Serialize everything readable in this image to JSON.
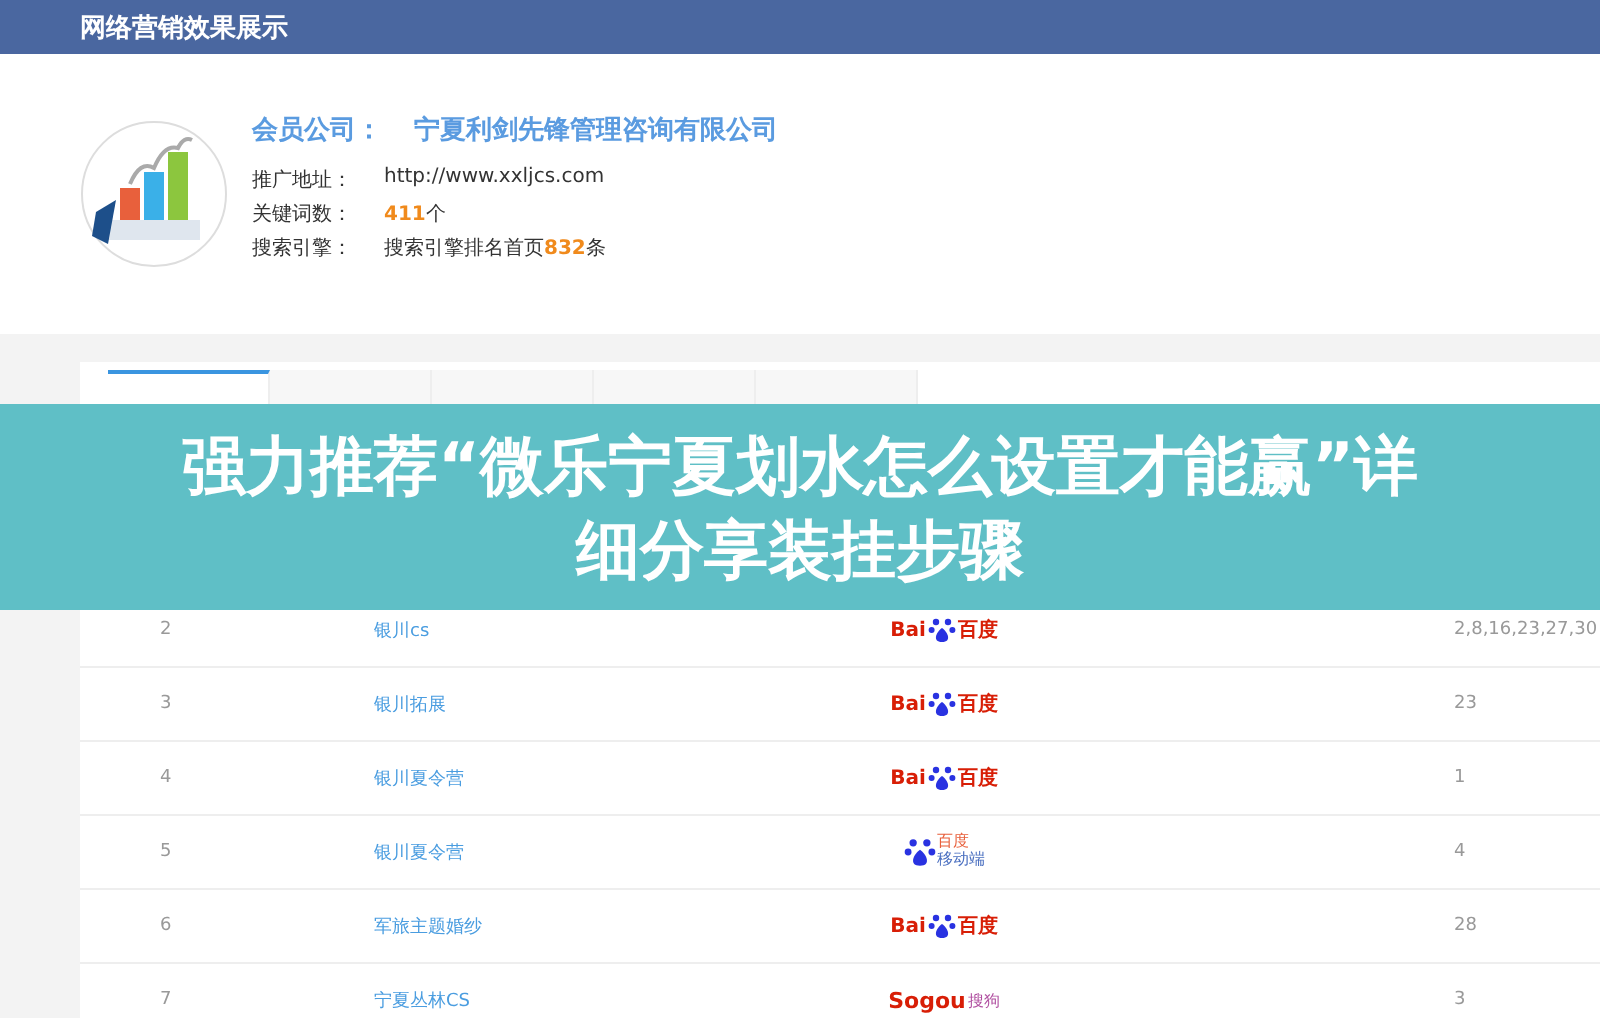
{
  "header": {
    "title": "网络营销效果展示"
  },
  "profile": {
    "company_label": "会员公司：",
    "company": "宁夏利剑先锋管理咨询有限公司",
    "fields": [
      {
        "label": "推广地址：",
        "value": "http://www.xxljcs.com"
      },
      {
        "label": "关键词数：",
        "number": "411",
        "suffix": "个"
      },
      {
        "label": "搜索引擎：",
        "value": "搜索引擎排名首页",
        "number": "832",
        "suffix": "条"
      }
    ]
  },
  "tabs": [
    {
      "selected": true
    },
    {
      "selected": false
    },
    {
      "selected": false
    },
    {
      "selected": false
    },
    {
      "selected": false
    }
  ],
  "table": {
    "rows": [
      {
        "index": "2",
        "keyword": "银川cs",
        "engine": {
          "kind": "baidu",
          "texts": [
            "Bai",
            "百度"
          ]
        },
        "rank": "2,8,16,23,27,30"
      },
      {
        "index": "3",
        "keyword": "银川拓展",
        "engine": {
          "kind": "baidu",
          "texts": [
            "Bai",
            "百度"
          ]
        },
        "rank": "23"
      },
      {
        "index": "4",
        "keyword": "银川夏令营",
        "engine": {
          "kind": "baidu",
          "texts": [
            "Bai",
            "百度"
          ]
        },
        "rank": "1"
      },
      {
        "index": "5",
        "keyword": "银川夏令营",
        "engine": {
          "kind": "baidu_mobile",
          "texts": [
            "百度",
            "移动端"
          ]
        },
        "rank": "4"
      },
      {
        "index": "6",
        "keyword": "军旅主题婚纱",
        "engine": {
          "kind": "baidu",
          "texts": [
            "Bai",
            "百度"
          ]
        },
        "rank": "28"
      },
      {
        "index": "7",
        "keyword": "宁夏丛林CS",
        "engine": {
          "kind": "sogou",
          "texts": [
            "Sogou",
            "搜狗"
          ]
        },
        "rank": "3"
      }
    ]
  },
  "banner": {
    "headline": "强力推荐“微乐宁夏划水怎么设置才能赢”详细分享装挂步骤"
  }
}
